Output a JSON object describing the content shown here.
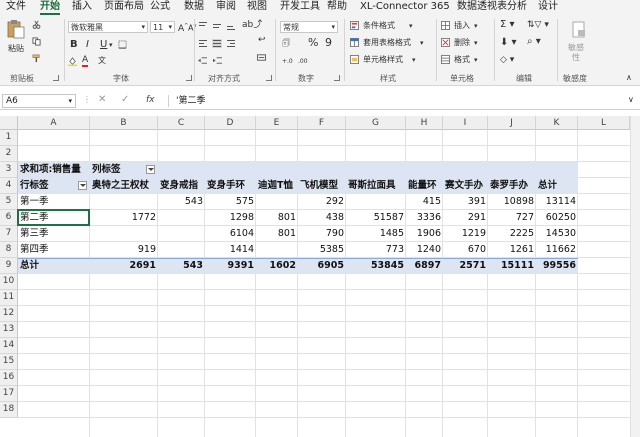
{
  "menu": {
    "tabs": [
      "文件",
      "开始",
      "插入",
      "页面布局",
      "公式",
      "数据",
      "审阅",
      "视图",
      "开发工具",
      "帮助",
      "XL-Connector 365",
      "数据透视表分析",
      "设计"
    ],
    "active": "开始"
  },
  "ribbon": {
    "clipboard": {
      "paste": "粘贴",
      "label": "剪贴板"
    },
    "font": {
      "name": "微软雅黑",
      "size": "11",
      "label": "字体"
    },
    "alignment": {
      "label": "对齐方式"
    },
    "number": {
      "format": "常规",
      "label": "数字"
    },
    "styles": {
      "items": [
        "条件格式",
        "套用表格格式",
        "单元格样式"
      ],
      "label": "样式"
    },
    "cells": {
      "items": [
        "插入",
        "删除",
        "格式"
      ],
      "label": "单元格"
    },
    "editing": {
      "label": "编辑"
    },
    "sensitivity": {
      "button": "敏感\n性",
      "label": "敏感度"
    }
  },
  "formula_bar": {
    "name_box": "A6",
    "formula": "'第二季"
  },
  "columns": [
    "A",
    "B",
    "C",
    "D",
    "E",
    "F",
    "G",
    "H",
    "I",
    "J",
    "K",
    "L"
  ],
  "row_numbers": [
    "1",
    "2",
    "3",
    "4",
    "5",
    "6",
    "7",
    "8",
    "9",
    "10",
    "11",
    "12",
    "13",
    "14",
    "15",
    "16",
    "17",
    "18"
  ],
  "pivot": {
    "value_field": "求和项:销售量",
    "col_labels_caption": "列标签",
    "row_labels_caption": "行标签",
    "headers": [
      "奥特之王权杖",
      "变身戒指",
      "变身手环",
      "迪迦T恤",
      "飞机模型",
      "哥斯拉面具",
      "能量环",
      "赛文手办",
      "泰罗手办",
      "总计"
    ],
    "rows": [
      {
        "label": "第一季",
        "values": [
          "",
          "543",
          "575",
          "",
          "292",
          "",
          "415",
          "391",
          "10898",
          "13114"
        ]
      },
      {
        "label": "第二季",
        "values": [
          "1772",
          "",
          "1298",
          "801",
          "438",
          "51587",
          "3336",
          "291",
          "727",
          "60250"
        ]
      },
      {
        "label": "第三季",
        "values": [
          "",
          "",
          "6104",
          "801",
          "790",
          "1485",
          "1906",
          "1219",
          "2225",
          "14530"
        ]
      },
      {
        "label": "第四季",
        "values": [
          "919",
          "",
          "1414",
          "",
          "5385",
          "773",
          "1240",
          "670",
          "1261",
          "11662"
        ]
      }
    ],
    "total": {
      "label": "总计",
      "values": [
        "2691",
        "543",
        "9391",
        "1602",
        "6905",
        "53845",
        "6897",
        "2571",
        "15111",
        "99556"
      ]
    }
  }
}
